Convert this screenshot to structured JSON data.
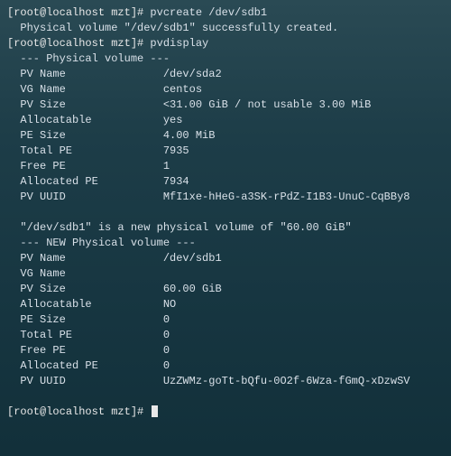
{
  "prompt1": {
    "open": "[",
    "user": "root@localhost mzt",
    "close": "]#",
    "cmd": " pvcreate /dev/sdb1"
  },
  "out1": "  Physical volume \"/dev/sdb1\" successfully created.",
  "prompt2": {
    "open": "[",
    "user": "root@localhost mzt",
    "close": "]#",
    "cmd": " pvdisplay"
  },
  "pv_header": "  --- Physical volume ---",
  "pv": {
    "name_k": "  PV Name               ",
    "name_v": "/dev/sda2",
    "vg_k": "  VG Name               ",
    "vg_v": "centos",
    "size_k": "  PV Size               ",
    "size_v": "<31.00 GiB / not usable 3.00 MiB",
    "alloc_k": "  Allocatable           ",
    "alloc_v": "yes",
    "pe_k": "  PE Size               ",
    "pe_v": "4.00 MiB",
    "tpe_k": "  Total PE              ",
    "tpe_v": "7935",
    "fpe_k": "  Free PE               ",
    "fpe_v": "1",
    "ape_k": "  Allocated PE          ",
    "ape_v": "7934",
    "uuid_k": "  PV UUID               ",
    "uuid_v": "MfI1xe-hHeG-a3SK-rPdZ-I1B3-UnuC-CqBBy8"
  },
  "blank": " ",
  "new_msg": "  \"/dev/sdb1\" is a new physical volume of \"60.00 GiB\"",
  "new_header": "  --- NEW Physical volume ---",
  "npv": {
    "name_k": "  PV Name               ",
    "name_v": "/dev/sdb1",
    "vg_k": "  VG Name               ",
    "vg_v": "",
    "size_k": "  PV Size               ",
    "size_v": "60.00 GiB",
    "alloc_k": "  Allocatable           ",
    "alloc_v": "NO",
    "pe_k": "  PE Size               ",
    "pe_v": "0",
    "tpe_k": "  Total PE              ",
    "tpe_v": "0",
    "fpe_k": "  Free PE               ",
    "fpe_v": "0",
    "ape_k": "  Allocated PE          ",
    "ape_v": "0",
    "uuid_k": "  PV UUID               ",
    "uuid_v": "UzZWMz-goTt-bQfu-0O2f-6Wza-fGmQ-xDzwSV"
  },
  "prompt3": {
    "open": "[",
    "user": "root@localhost mzt",
    "close": "]#",
    "cmd": " "
  }
}
